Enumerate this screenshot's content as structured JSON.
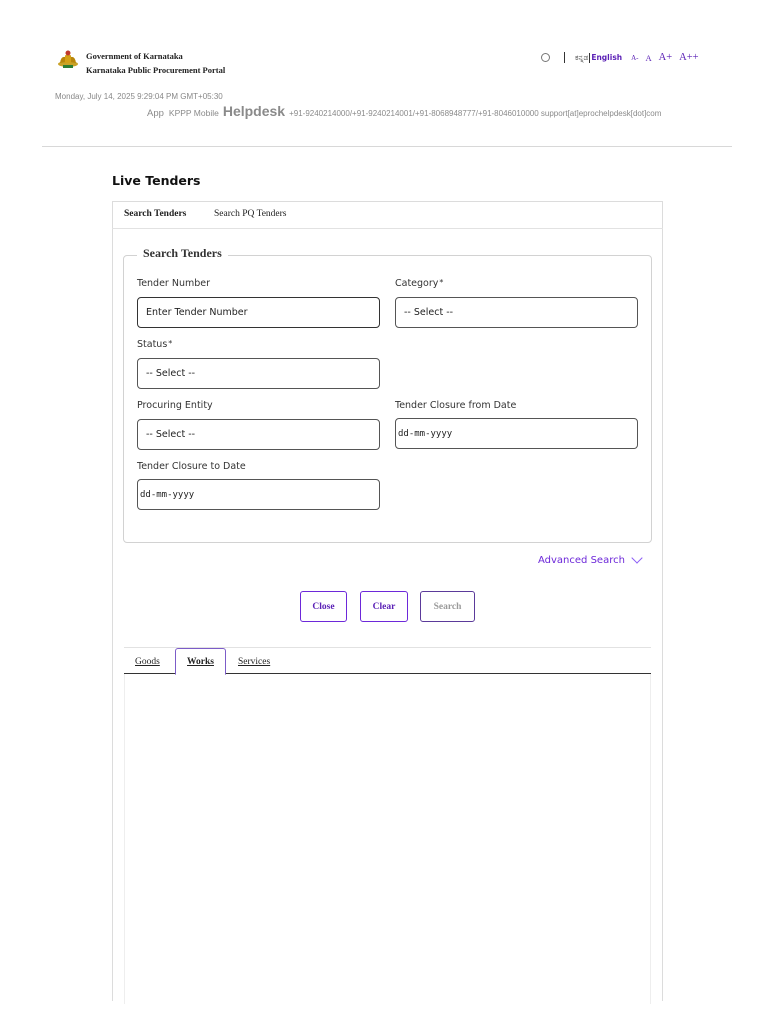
{
  "header": {
    "gov_line1": "Government of Karnataka",
    "gov_line2": "Karnataka Public Procurement Portal",
    "emblem_icon": "karnataka-emblem-icon",
    "lang_kannada": "ಕನ್ನಡ",
    "lang_english": "English",
    "font_small": "A-",
    "font_normal": "A",
    "font_large": "A+",
    "font_xlarge": "A++",
    "datetime": "Monday, July 14, 2025 9:29:04 PM GMT+05:30",
    "app_label": "App",
    "kppp_mobile": "KPPP Mobile",
    "helpdesk_label": "Helpdesk",
    "helpdesk_contacts": "+91-9240214000/+91-9240214001/+91-8068948777/+91-8046010000 support[at]eprochelpdesk[dot]com"
  },
  "page": {
    "title": "Live Tenders",
    "tabs": [
      {
        "label": "Search Tenders"
      },
      {
        "label": "Search PQ Tenders"
      }
    ]
  },
  "form": {
    "legend": "Search Tenders",
    "tender_number_label": "Tender Number",
    "tender_number_placeholder": "Enter Tender Number",
    "category_label": "Category",
    "category_value": "-- Select --",
    "status_label": "Status",
    "status_value": "-- Select --",
    "procuring_entity_label": "Procuring Entity",
    "procuring_entity_value": "-- Select --",
    "closure_from_label": "Tender Closure from Date",
    "closure_from_value": "dd-mm-yyyy",
    "closure_to_label": "Tender Closure to Date",
    "closure_to_value": "dd-mm-yyyy",
    "required_mark": "*"
  },
  "advanced_search": "Advanced Search",
  "buttons": {
    "close": "Close",
    "clear": "Clear",
    "search": "Search"
  },
  "result_tabs": [
    {
      "label": "Goods"
    },
    {
      "label": "Works"
    },
    {
      "label": "Services"
    }
  ],
  "colors": {
    "accent": "#6d28d9",
    "muted_text": "#888888"
  }
}
